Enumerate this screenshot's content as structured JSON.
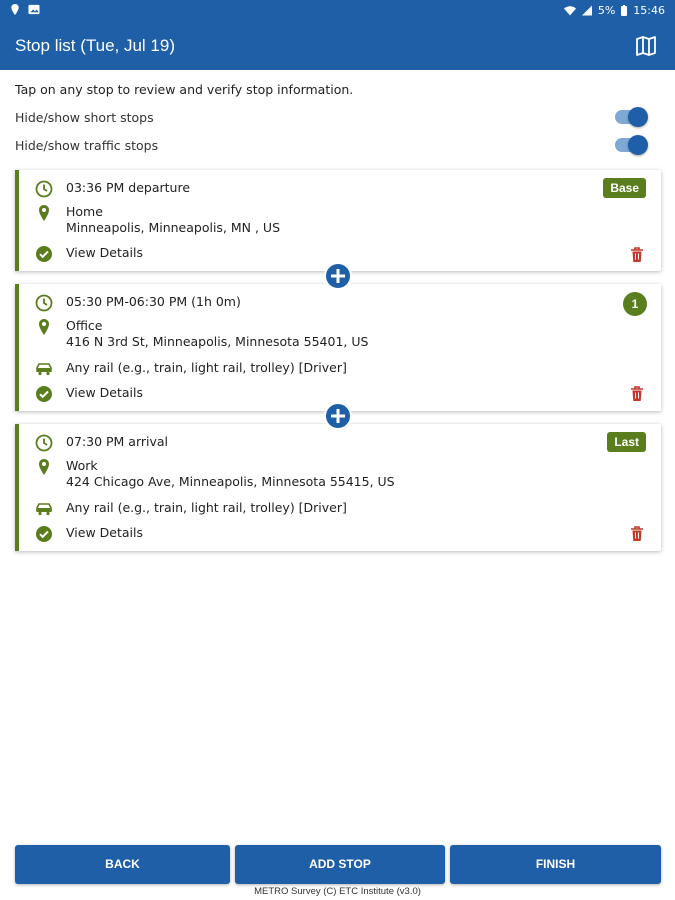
{
  "status_bar": {
    "battery": "5%",
    "time": "15:46"
  },
  "header": {
    "title": "Stop list (Tue, Jul 19)",
    "map_icon": "map-icon"
  },
  "instructions": "Tap on any stop to review and verify stop information.",
  "toggles": [
    {
      "label": "Hide/show short stops",
      "on": true
    },
    {
      "label": "Hide/show traffic stops",
      "on": true
    }
  ],
  "stops": [
    {
      "time": "03:36 PM departure",
      "badge": "Base",
      "place": "Home",
      "address": "Minneapolis, Minneapolis, MN , US",
      "mode": "",
      "details": "View Details"
    },
    {
      "time": "05:30 PM-06:30 PM (1h 0m)",
      "badge": "1",
      "place": "Office",
      "address": "416 N 3rd St, Minneapolis, Minnesota 55401, US",
      "mode": "Any rail (e.g., train, light rail, trolley) [Driver]",
      "details": "View Details"
    },
    {
      "time": "07:30 PM arrival",
      "badge": "Last",
      "place": "Work",
      "address": "424 Chicago Ave, Minneapolis, Minnesota 55415, US",
      "mode": "Any rail (e.g., train, light rail, trolley) [Driver]",
      "details": "View Details"
    }
  ],
  "buttons": {
    "back": "BACK",
    "add_stop": "ADD STOP",
    "finish": "FINISH"
  },
  "footer": "METRO Survey (C) ETC Institute (v3.0)",
  "colors": {
    "primary": "#1f5fa8",
    "green": "#5a7d1d",
    "delete": "#c0392b"
  }
}
